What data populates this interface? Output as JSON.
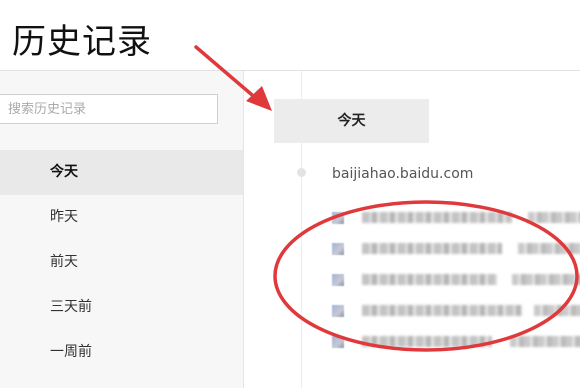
{
  "page": {
    "title": "历史记录"
  },
  "search": {
    "placeholder": "搜索历史记录",
    "value": ""
  },
  "sidebar": {
    "items": [
      {
        "label": "今天",
        "active": true
      },
      {
        "label": "昨天",
        "active": false
      },
      {
        "label": "前天",
        "active": false
      },
      {
        "label": "三天前",
        "active": false
      },
      {
        "label": "一周前",
        "active": false
      }
    ]
  },
  "main": {
    "date_label": "今天",
    "domain": "baijiahao.baidu.com",
    "entries_count_visible": 5
  },
  "colors": {
    "annotation": "#e0393b",
    "active_bg": "#e9e9e9",
    "sidebar_bg": "#f7f7f7"
  }
}
